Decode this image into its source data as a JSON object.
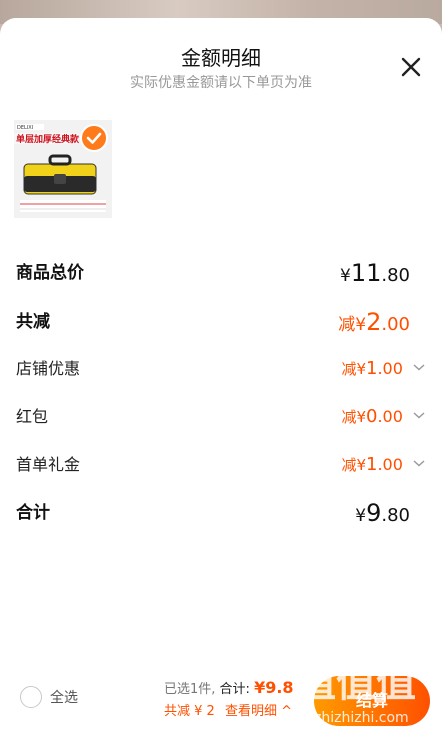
{
  "sheet": {
    "title": "金额明细",
    "subtitle": "实际优惠金额请以下单页为准"
  },
  "product": {
    "brand_text": "DELIXI",
    "banner_text": "单层加厚经典款"
  },
  "rows": {
    "goods_total": {
      "label": "商品总价",
      "prefix": "¥",
      "int": "11",
      "dec": ".80"
    },
    "total_reduce": {
      "label": "共减",
      "prefix": "减¥",
      "int": "2",
      "dec": ".00"
    },
    "shop_discount": {
      "label": "店铺优惠",
      "prefix": "减¥",
      "int": "1",
      "dec": ".00"
    },
    "red_packet": {
      "label": "红包",
      "prefix": "减¥",
      "int": "0",
      "dec": ".00"
    },
    "first_order_gift": {
      "label": "首单礼金",
      "prefix": "减¥",
      "int": "1",
      "dec": ".00"
    },
    "grand_total": {
      "label": "合计",
      "prefix": "¥",
      "int": "9",
      "dec": ".80"
    }
  },
  "bottom_bar": {
    "select_all_label": "全选",
    "selected_text": "已选1件,",
    "total_label": "合计:",
    "total_value": "¥9.8",
    "reduce_text": "共减 ¥ 2",
    "detail_link": "查看明细 ^",
    "checkout_label": "结算"
  },
  "watermark": {
    "logo_text": "值值值",
    "url_text": "zhizhizhi.com"
  },
  "colors": {
    "accent": "#ff5000",
    "checkout_start": "#ff9a00"
  }
}
